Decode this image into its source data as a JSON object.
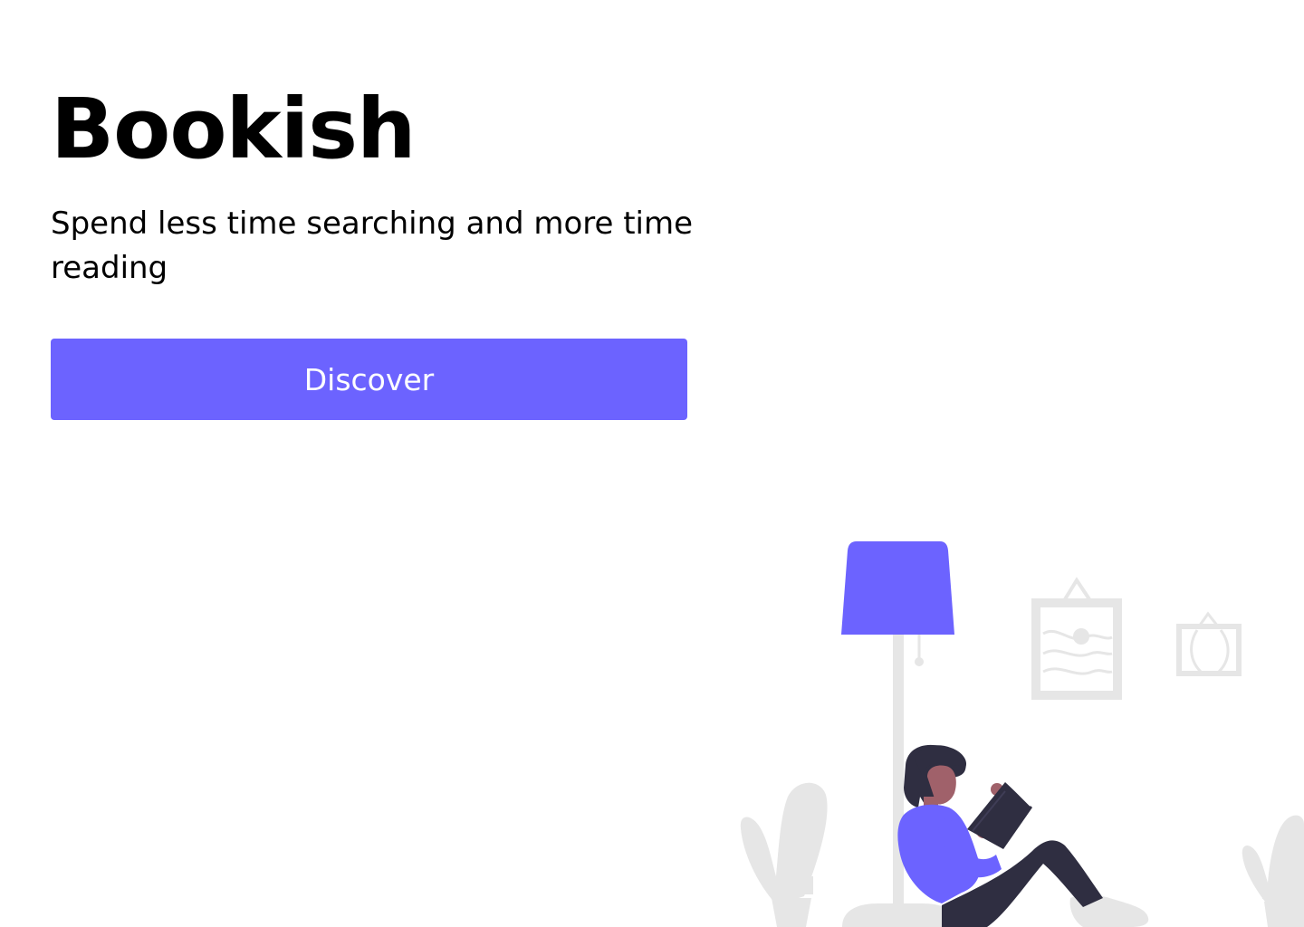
{
  "hero": {
    "title": "Bookish",
    "subtitle": "Spend less time searching and more time reading",
    "button_label": "Discover"
  },
  "colors": {
    "accent": "#6c63ff",
    "background": "#ffffff",
    "text": "#000000",
    "illustration_gray": "#e6e6e6",
    "dark": "#2f2e41"
  },
  "illustration": {
    "icon": "woman-reading-under-lamp"
  }
}
